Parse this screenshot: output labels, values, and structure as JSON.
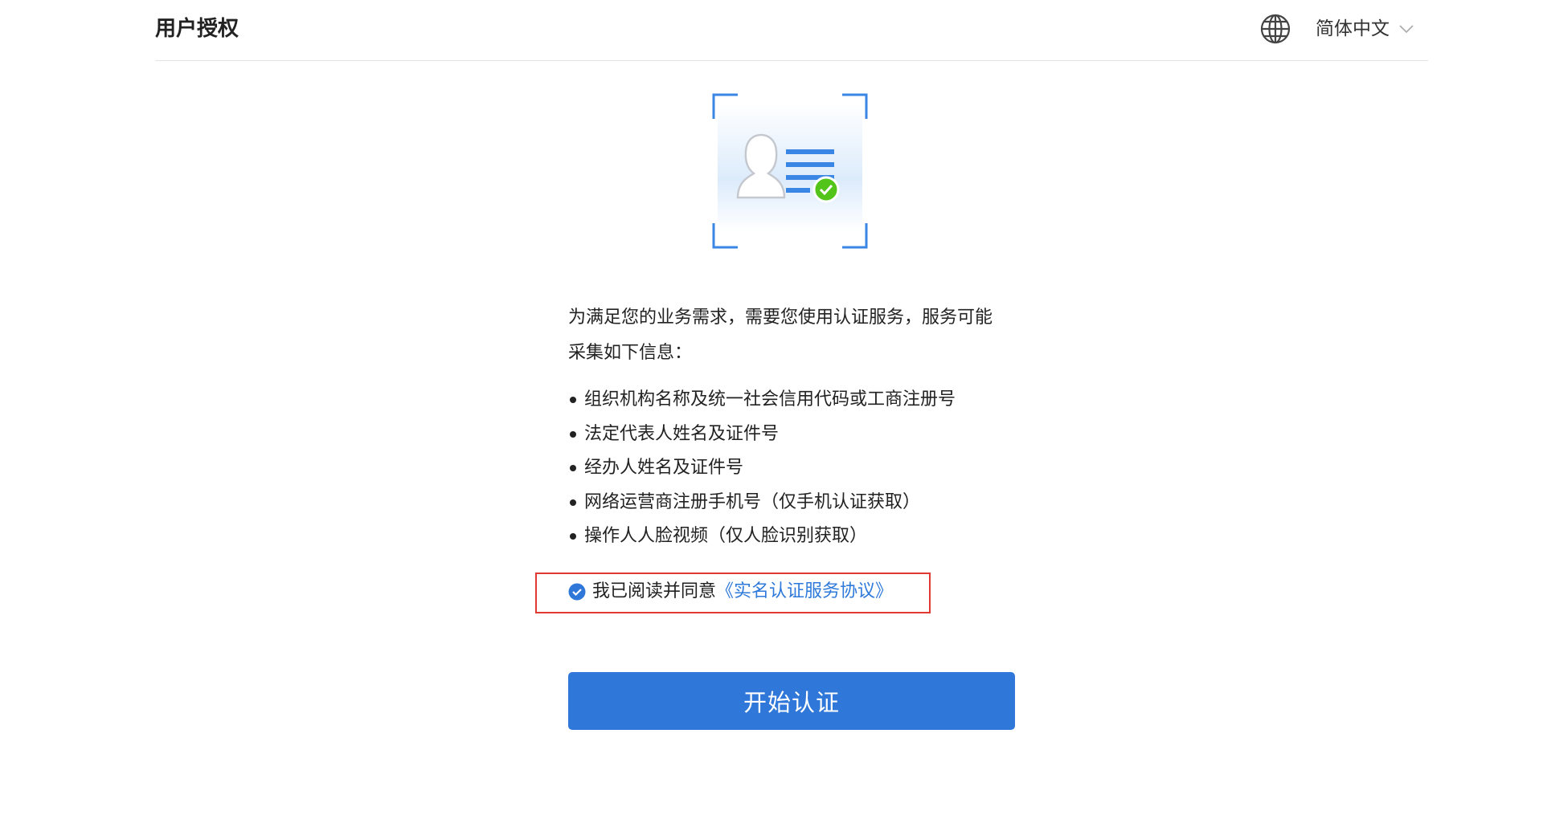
{
  "header": {
    "title": "用户授权",
    "language": {
      "icon": "globe-icon",
      "label": "简体中文",
      "dropdown_icon": "chevron-down-icon"
    }
  },
  "illustration": {
    "icon": "identity-verification-illustration"
  },
  "content": {
    "intro_line1": "为满足您的业务需求，需要您使用认证服务，服务可能",
    "intro_line2": "采集如下信息：",
    "items": [
      "组织机构名称及统一社会信用代码或工商注册号",
      "法定代表人姓名及证件号",
      "经办人姓名及证件号",
      "网络运营商注册手机号（仅手机认证获取）",
      "操作人人脸视频（仅人脸识别获取）"
    ]
  },
  "agreement": {
    "checked": true,
    "text": "我已阅读并同意",
    "link": "《实名认证服务协议》"
  },
  "action": {
    "start_label": "开始认证"
  },
  "colors": {
    "accent": "#2f77d9",
    "link": "#2e79da",
    "success": "#52c41a",
    "highlight_border": "#e23a33"
  }
}
